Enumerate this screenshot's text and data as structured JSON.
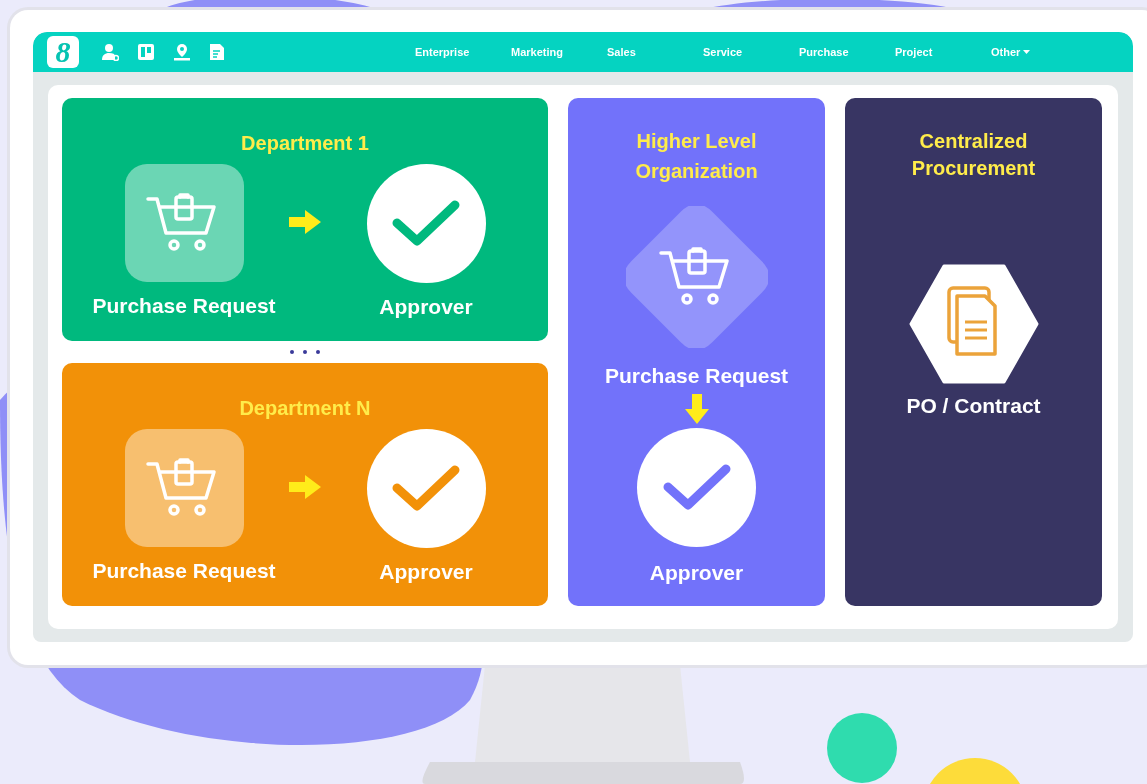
{
  "nav": {
    "logo": "8",
    "items": [
      {
        "label": "Enterprise",
        "dropdown": false
      },
      {
        "label": "Marketing",
        "dropdown": false
      },
      {
        "label": "Sales",
        "dropdown": false
      },
      {
        "label": "Service",
        "dropdown": false
      },
      {
        "label": "Purchase",
        "dropdown": false
      },
      {
        "label": "Project",
        "dropdown": false
      },
      {
        "label": "Other",
        "dropdown": true
      }
    ]
  },
  "departments": [
    {
      "title": "Department 1",
      "color": "#00b97e",
      "request": "Purchase Request",
      "approver": "Approver"
    },
    {
      "title": "Department N",
      "color": "#f29108",
      "request": "Purchase Request",
      "approver": "Approver"
    }
  ],
  "higher_level": {
    "title": "Higher Level Organization",
    "request": "Purchase Request",
    "approver": "Approver"
  },
  "centralized": {
    "title": "Centralized Procurement",
    "output": "PO / Contract"
  }
}
